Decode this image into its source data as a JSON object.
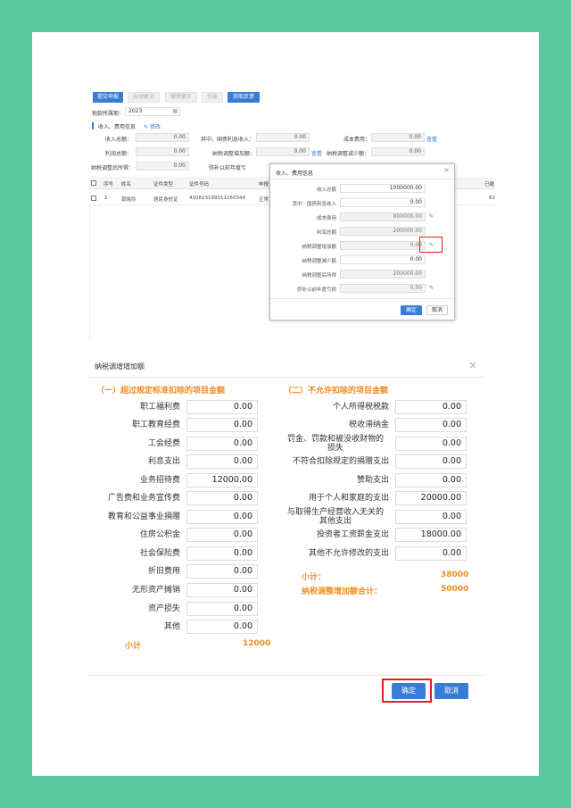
{
  "top": {
    "toolbar": {
      "submit": "提交申报",
      "restart": "启动更正",
      "revoke": "撤销更正",
      "cancel": "作废",
      "feedback": "获取反馈"
    },
    "period_label": "税款所属期：",
    "period_value": "2023",
    "section_title": "收入、费用信息",
    "edit_link": "修改",
    "fields": {
      "income_total_label": "收入总额：",
      "income_total_value": "0.00",
      "treasury_label": "其中，国债利息收入：",
      "treasury_value": "0.00",
      "cost_label": "成本费用：",
      "cost_value": "0.00",
      "view": "查看",
      "profit_label": "利润总额：",
      "profit_value": "0.00",
      "adj_inc_label": "纳税调整增加额：",
      "adj_inc_value": "0.00",
      "adj_dec_label": "纳税调整减少额：",
      "adj_dec_value": "0.00",
      "after_adj_label": "纳税调整后所得：",
      "after_adj_value": "0.00",
      "loss_label": "弥补以前年度亏"
    },
    "table": {
      "headers": [
        "序号",
        "姓名",
        "证件类型",
        "证件号码",
        "申报"
      ],
      "right_header": "已缴",
      "row": {
        "no": "1",
        "name": "郭晓玲",
        "id_type": "居民身份证",
        "id_number": "410823199311150344",
        "status": "正常",
        "right": "62"
      }
    },
    "popup": {
      "title": "收入、费用信息",
      "close": "×",
      "rows": [
        {
          "label": "收入总额",
          "value": "1000000.00"
        },
        {
          "label": "其中：国债利息收入",
          "value": "0.00"
        },
        {
          "label": "成本费用",
          "value": "800000.00"
        },
        {
          "label": "利润总额",
          "value": "200000.00"
        },
        {
          "label": "纳税调整增加额",
          "value": "0.00"
        },
        {
          "label": "纳税调整减少额",
          "value": "0.00"
        },
        {
          "label": "纳税调整后所得",
          "value": "200000.00"
        },
        {
          "label": "弥补以前年度亏损",
          "value": "0.00"
        }
      ],
      "ok": "确定",
      "cancel": "取消"
    }
  },
  "dialog": {
    "title": "纳税调增增加额",
    "close": "×",
    "sec1_title": "（一）超过规定标准扣除的项目金额",
    "sec2_title": "（二）不允许扣除的项目金额",
    "col1": [
      {
        "label": "职工福利费",
        "value": "0.00"
      },
      {
        "label": "职工教育经费",
        "value": "0.00"
      },
      {
        "label": "工会经费",
        "value": "0.00"
      },
      {
        "label": "利息支出",
        "value": "0.00"
      },
      {
        "label": "业务招待费",
        "value": "12000.00"
      },
      {
        "label": "广告费和业务宣传费",
        "value": "0.00"
      },
      {
        "label": "教育和公益事业捐赠",
        "value": "0.00"
      },
      {
        "label": "住房公积金",
        "value": "0.00"
      },
      {
        "label": "社会保险费",
        "value": "0.00"
      },
      {
        "label": "折旧费用",
        "value": "0.00"
      },
      {
        "label": "无形资产摊销",
        "value": "0.00"
      },
      {
        "label": "资产损失",
        "value": "0.00"
      },
      {
        "label": "其他",
        "value": "0.00"
      }
    ],
    "col1_subtotal_label": "小计",
    "col1_subtotal_value": "12000",
    "col2": [
      {
        "label": "个人所得税税款",
        "value": "0.00"
      },
      {
        "label": "税收滞纳金",
        "value": "0.00"
      },
      {
        "label": "罚金、罚款和被没收财物的损失",
        "value": "0.00"
      },
      {
        "label": "不符合扣除规定的捐赠支出",
        "value": "0.00"
      },
      {
        "label": "赞助支出",
        "value": "0.00"
      },
      {
        "label": "用于个人和家庭的支出",
        "value": "20000.00"
      },
      {
        "label": "与取得生产经营收入无关的其他支出",
        "value": "0.00"
      },
      {
        "label": "投资者工资薪金支出",
        "value": "18000.00"
      },
      {
        "label": "其他不允许修改的支出",
        "value": "0.00"
      }
    ],
    "col2_subtotal_label": "小计：",
    "col2_subtotal_value": "38000",
    "total_label": "纳税调整增加额合计：",
    "total_value": "50000",
    "ok": "确定",
    "cancel": "取消"
  }
}
